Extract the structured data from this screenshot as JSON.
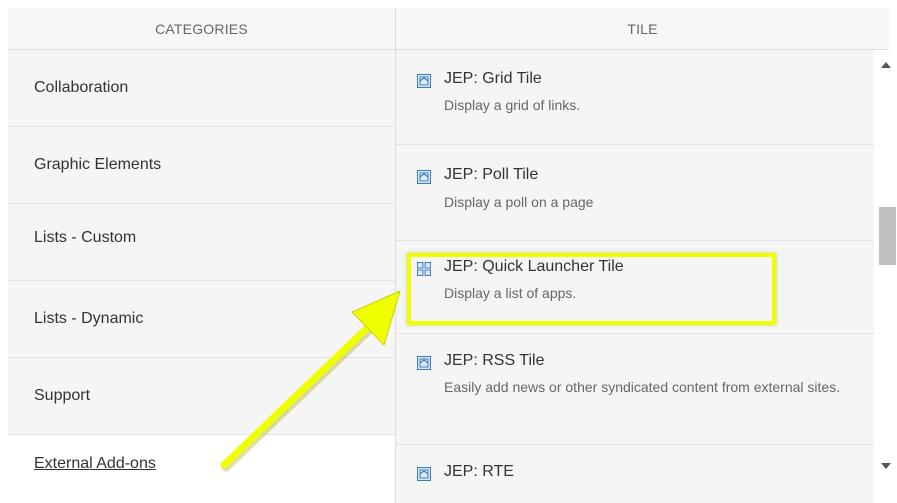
{
  "headers": {
    "categories": "CATEGORIES",
    "tile": "TILE"
  },
  "categories": [
    {
      "label": "Collaboration"
    },
    {
      "label": "Graphic Elements"
    },
    {
      "label": "Lists - Custom"
    },
    {
      "label": "Lists - Dynamic"
    },
    {
      "label": "Support"
    },
    {
      "label": "External Add-ons",
      "active": true
    }
  ],
  "tiles": [
    {
      "title": "JEP: Grid Tile",
      "description": "Display a grid of links.",
      "icon": "tile-icon"
    },
    {
      "title": "JEP: Poll Tile",
      "description": "Display a poll on a page",
      "icon": "tile-icon"
    },
    {
      "title": "JEP: Quick Launcher Tile",
      "description": "Display a list of apps.",
      "icon": "grid-icon",
      "highlighted": true
    },
    {
      "title": "JEP: RSS Tile",
      "description": "Easily add news or other syndicated content from external sites.",
      "icon": "tile-icon"
    },
    {
      "title": "JEP: RTE",
      "description": "",
      "icon": "tile-icon"
    }
  ],
  "colors": {
    "highlight": "#f0ff00",
    "icon": "#3a7bbf"
  }
}
